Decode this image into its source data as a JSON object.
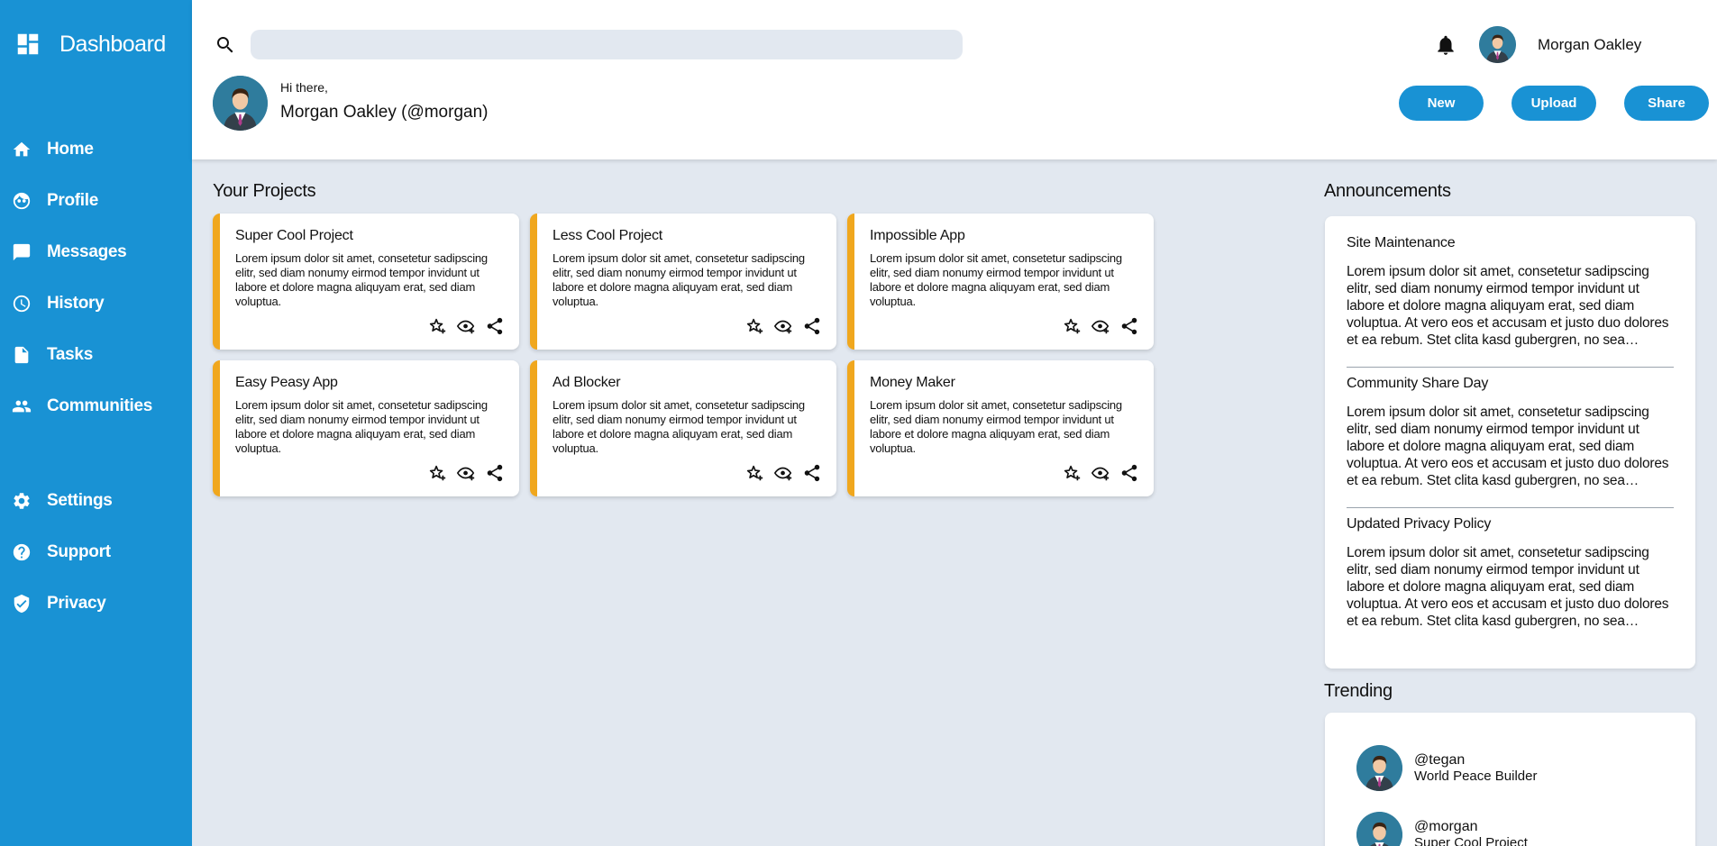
{
  "sidebar": {
    "brand": "Dashboard",
    "items": [
      {
        "label": "Home",
        "icon": "home-icon"
      },
      {
        "label": "Profile",
        "icon": "profile-icon"
      },
      {
        "label": "Messages",
        "icon": "messages-icon"
      },
      {
        "label": "History",
        "icon": "history-icon"
      },
      {
        "label": "Tasks",
        "icon": "tasks-icon"
      },
      {
        "label": "Communities",
        "icon": "communities-icon"
      },
      {
        "label": "Settings",
        "icon": "gear-icon"
      },
      {
        "label": "Support",
        "icon": "help-icon"
      },
      {
        "label": "Privacy",
        "icon": "shield-icon"
      }
    ]
  },
  "header": {
    "search_placeholder": "",
    "user_name": "Morgan Oakley",
    "greeting": "Hi there,",
    "greeting_name": "Morgan Oakley (@morgan)",
    "buttons": {
      "new": "New",
      "upload": "Upload",
      "share": "Share"
    }
  },
  "projects": {
    "title": "Your Projects",
    "cards": [
      {
        "title": "Super Cool Project",
        "desc": "Lorem ipsum dolor sit amet, consetetur sadipscing elitr, sed diam nonumy eirmod tempor invidunt ut labore et dolore magna aliquyam erat, sed diam voluptua."
      },
      {
        "title": "Less Cool Project",
        "desc": "Lorem ipsum dolor sit amet, consetetur sadipscing elitr, sed diam nonumy eirmod tempor invidunt ut labore et dolore magna aliquyam erat, sed diam voluptua."
      },
      {
        "title": "Impossible App",
        "desc": "Lorem ipsum dolor sit amet, consetetur sadipscing elitr, sed diam nonumy eirmod tempor invidunt ut labore et dolore magna aliquyam erat, sed diam voluptua."
      },
      {
        "title": "Easy Peasy App",
        "desc": "Lorem ipsum dolor sit amet, consetetur sadipscing elitr, sed diam nonumy eirmod tempor invidunt ut labore et dolore magna aliquyam erat, sed diam voluptua."
      },
      {
        "title": "Ad Blocker",
        "desc": "Lorem ipsum dolor sit amet, consetetur sadipscing elitr, sed diam nonumy eirmod tempor invidunt ut labore et dolore magna aliquyam erat, sed diam voluptua."
      },
      {
        "title": "Money Maker",
        "desc": "Lorem ipsum dolor sit amet, consetetur sadipscing elitr, sed diam nonumy eirmod tempor invidunt ut labore et dolore magna aliquyam erat, sed diam voluptua."
      }
    ]
  },
  "announcements": {
    "title": "Announcements",
    "items": [
      {
        "title": "Site Maintenance",
        "text": "Lorem ipsum dolor sit amet, consetetur sadipscing elitr, sed diam nonumy eirmod tempor invidunt ut labore et dolore magna aliquyam erat, sed diam voluptua. At vero eos et accusam et justo duo dolores et ea rebum. Stet clita kasd gubergren, no sea takimata sanctus est Lorem ipsum dolor sit amet."
      },
      {
        "title": "Community Share Day",
        "text": "Lorem ipsum dolor sit amet, consetetur sadipscing elitr, sed diam nonumy eirmod tempor invidunt ut labore et dolore magna aliquyam erat, sed diam voluptua. At vero eos et accusam et justo duo dolores et ea rebum. Stet clita kasd gubergren, no sea takimata sanctus est Lorem ipsum dolor sit amet."
      },
      {
        "title": "Updated Privacy Policy",
        "text": "Lorem ipsum dolor sit amet, consetetur sadipscing elitr, sed diam nonumy eirmod tempor invidunt ut labore et dolore magna aliquyam erat, sed diam voluptua. At vero eos et accusam et justo duo dolores et ea rebum. Stet clita kasd gubergren, no sea takimata sanctus est Lorem ipsum dolor sit amet."
      }
    ]
  },
  "trending": {
    "title": "Trending",
    "items": [
      {
        "handle": "@tegan",
        "project": "World Peace Builder"
      },
      {
        "handle": "@morgan",
        "project": "Super Cool Project"
      }
    ]
  },
  "colors": {
    "sidebar": "#1992d4",
    "accent": "#f0a71e",
    "background": "#e2e8f0"
  }
}
